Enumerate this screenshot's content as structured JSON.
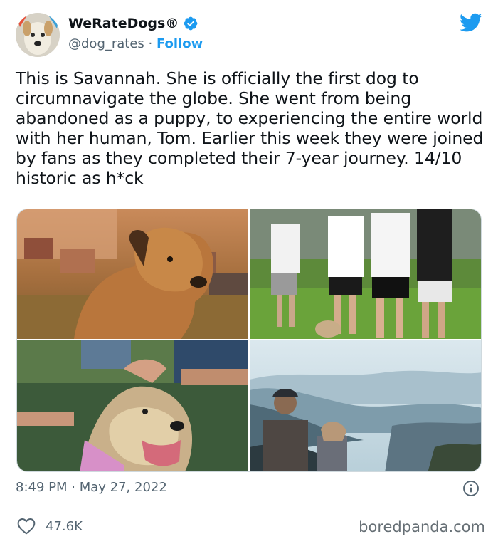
{
  "author": {
    "display_name": "WeRateDogs®",
    "handle": "@dog_rates",
    "separator": " · ",
    "follow_label": "Follow"
  },
  "icons": {
    "verified": "verified-badge-icon",
    "brand": "twitter-bird-icon",
    "info": "info-icon",
    "like": "heart-icon"
  },
  "tweet": {
    "text": "This is Savannah. She is officially the first dog to circumnavigate the globe. She went from being abandoned as a puppy, to experiencing the entire world with her human, Tom. Earlier this week they were joined by fans as they completed their 7-year journey. 14/10 historic as h*ck",
    "time": "8:49 PM",
    "date_separator": " · ",
    "date": "May 27, 2022"
  },
  "stats": {
    "likes": "47.6K"
  },
  "watermark": "boredpanda.com",
  "colors": {
    "accent": "#1d9bf0",
    "secondary_text": "#536471",
    "primary_text": "#0f1419"
  }
}
